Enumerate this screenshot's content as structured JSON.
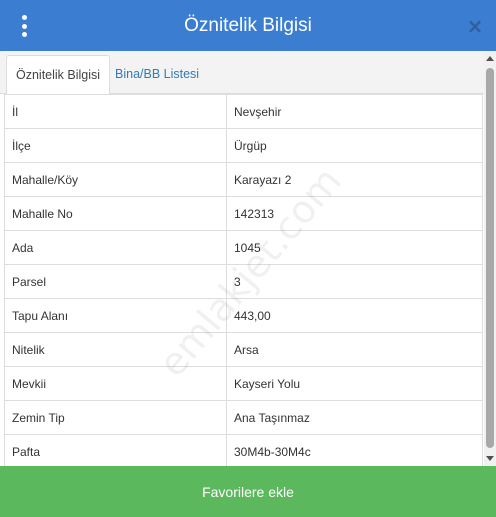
{
  "header": {
    "title": "Öznitelik Bilgisi",
    "close_glyph": "×",
    "menu_icon": "vertical-dots-icon",
    "close_icon": "close-icon",
    "background": "#3b7dd0"
  },
  "tabs": [
    {
      "label": "Öznitelik Bilgisi",
      "active": true
    },
    {
      "label": "Bina/BB Listesi",
      "active": false
    }
  ],
  "attributes": [
    {
      "key": "İl",
      "value": "Nevşehir"
    },
    {
      "key": "İlçe",
      "value": "Ürgüp"
    },
    {
      "key": "Mahalle/Köy",
      "value": "Karayazı 2"
    },
    {
      "key": "Mahalle No",
      "value": "142313"
    },
    {
      "key": "Ada",
      "value": "1045"
    },
    {
      "key": "Parsel",
      "value": "3"
    },
    {
      "key": "Tapu Alanı",
      "value": "443,00"
    },
    {
      "key": "Nitelik",
      "value": "Arsa"
    },
    {
      "key": "Mevkii",
      "value": "Kayseri Yolu"
    },
    {
      "key": "Zemin Tip",
      "value": "Ana Taşınmaz"
    },
    {
      "key": "Pafta",
      "value": "30M4b-30M4c"
    }
  ],
  "watermark": "emlakjet.com",
  "footer": {
    "button_label": "Favorilere ekle",
    "button_color": "#5cb85c"
  }
}
